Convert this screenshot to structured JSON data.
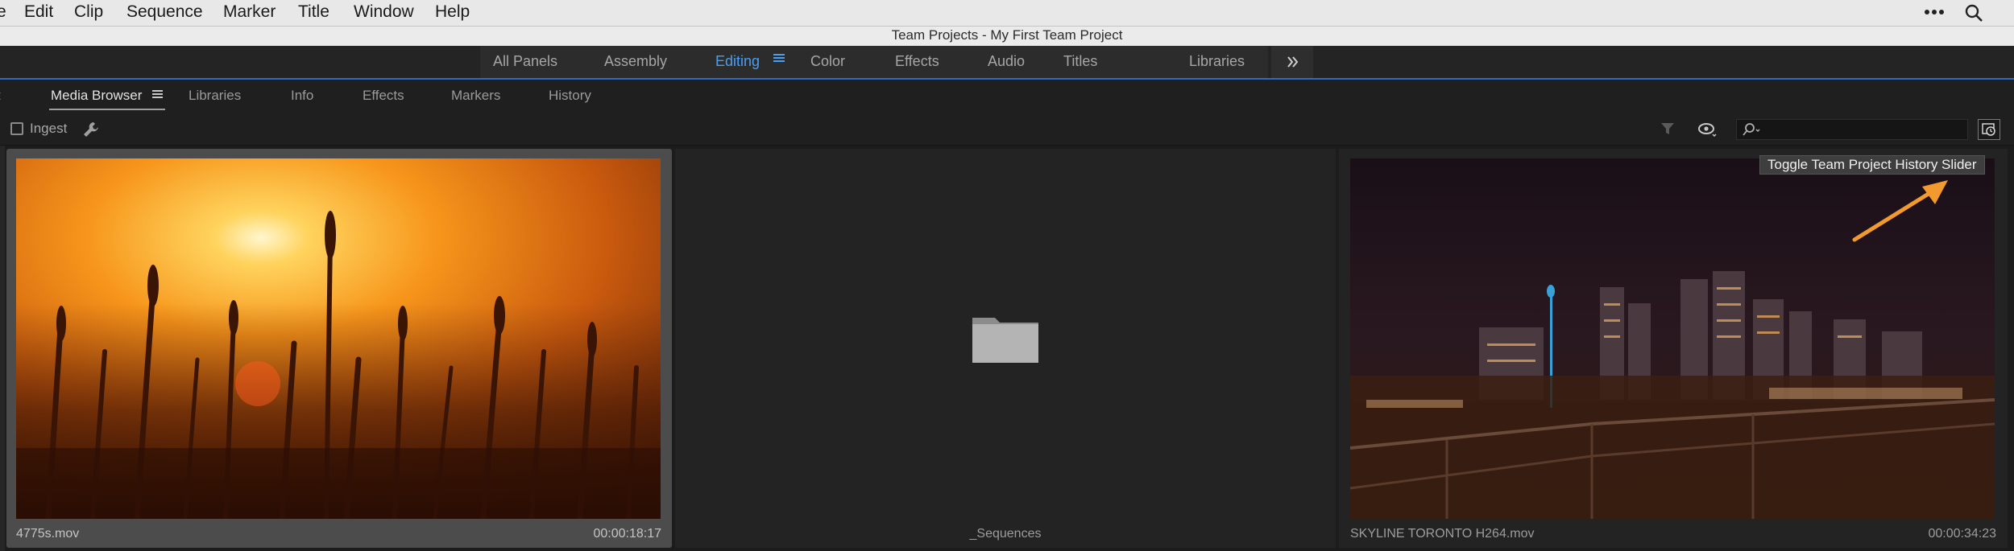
{
  "menubar": {
    "items": [
      "Edit",
      "Clip",
      "Sequence",
      "Marker",
      "Title",
      "Window",
      "Help"
    ],
    "icons": [
      "more-icon",
      "search-icon"
    ]
  },
  "window": {
    "title": "Team Projects - My First Team Project"
  },
  "workspaces": {
    "tabs": [
      "All Panels",
      "Assembly",
      "Editing",
      "Color",
      "Effects",
      "Audio",
      "Titles",
      "Libraries"
    ],
    "active": "Editing",
    "accent_color": "#4a9ef0",
    "overflow_icon": "double-chevron-right-icon"
  },
  "panel": {
    "tabs": [
      "Media Browser",
      "Libraries",
      "Info",
      "Effects",
      "Markers",
      "History"
    ],
    "active": "Media Browser"
  },
  "toolbar": {
    "ingest_label": "Ingest",
    "ingest_checked": false,
    "search_value": ""
  },
  "items": [
    {
      "name": "4775s.mov",
      "duration": "00:00:18:17",
      "selected": true
    },
    {
      "name": "_Sequences",
      "duration": "",
      "type": "folder"
    },
    {
      "name": "SKYLINE TORONTO H264.mov",
      "duration": "00:00:34:23"
    }
  ],
  "annotation": {
    "tooltip": "Toggle Team Project History Slider",
    "arrow_color": "#f29a2e"
  }
}
